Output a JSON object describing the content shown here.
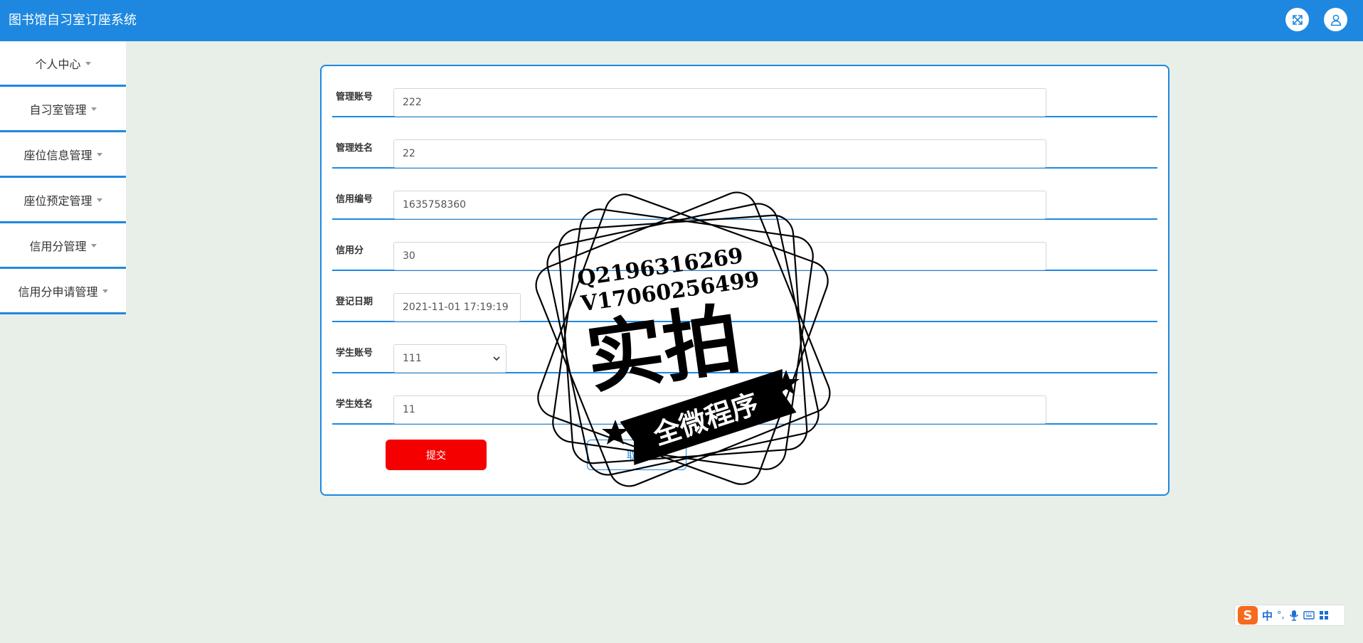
{
  "header": {
    "title": "图书馆自习室订座系统",
    "fullscreen_icon": "expand-arrows-icon",
    "user_icon": "user-icon"
  },
  "sidebar": {
    "items": [
      {
        "label": "个人中心"
      },
      {
        "label": "自习室管理"
      },
      {
        "label": "座位信息管理"
      },
      {
        "label": "座位预定管理"
      },
      {
        "label": "信用分管理"
      },
      {
        "label": "信用分申请管理"
      }
    ]
  },
  "form": {
    "fields": [
      {
        "label": "管理账号",
        "value": "222"
      },
      {
        "label": "管理姓名",
        "value": "22"
      },
      {
        "label": "信用编号",
        "value": "1635758360"
      },
      {
        "label": "信用分",
        "value": "30"
      },
      {
        "label": "登记日期",
        "value": "2021-11-01 17:19:19"
      },
      {
        "label": "学生账号",
        "value": "111"
      },
      {
        "label": "学生姓名",
        "value": "11"
      }
    ],
    "submit_label": "提交",
    "cancel_label": "取消"
  },
  "watermark": {
    "line1": "Q2196316269",
    "line2": "V17060256499",
    "main": "实拍",
    "ribbon": "全微程序"
  },
  "ime": {
    "logo": "S",
    "lang": "中",
    "punct": "°,",
    "icons": [
      "microphone-icon",
      "keyboard-icon",
      "grid-icon"
    ]
  },
  "colors": {
    "primary": "#1e88e0",
    "submit": "#f50000",
    "background": "#e8efe9"
  }
}
